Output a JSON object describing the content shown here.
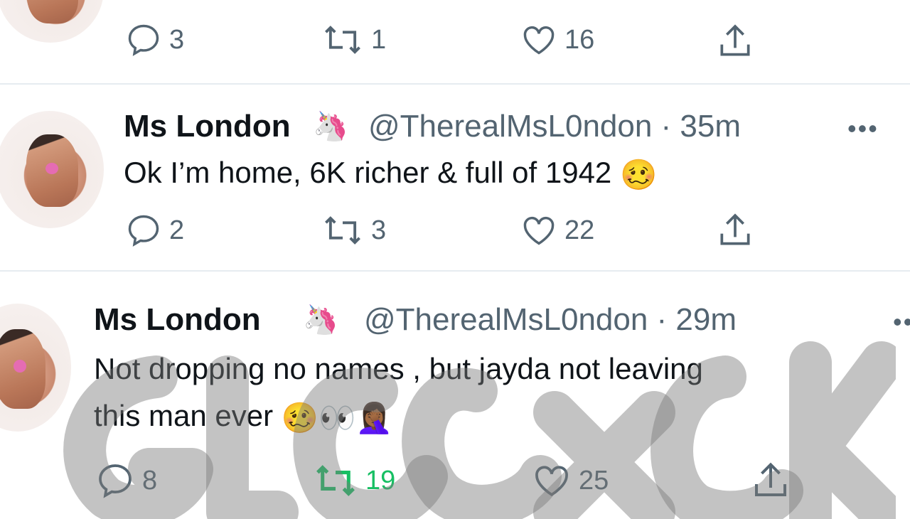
{
  "tweets": [
    {
      "name": "",
      "handle": "",
      "time": "",
      "text": "",
      "replies": "3",
      "retweets": "1",
      "likes": "16"
    },
    {
      "name": "Ms London",
      "handle": "@TherealMsL0ndon · 35m",
      "text": "Ok I’m home, 6K richer & full of 1942",
      "emoji": "🥴",
      "replies": "2",
      "retweets": "3",
      "likes": "22"
    },
    {
      "name": "Ms London",
      "handle": "@TherealMsL0ndon · 29m",
      "text_line1": "Not dropping no names , but jayda not leaving",
      "text_line2": "this man ever",
      "emojis": "🥴👀🤦🏾‍♀️",
      "replies": "8",
      "retweets": "19",
      "likes": "25"
    }
  ],
  "icons": {
    "unicorn": "🦄",
    "more": "•••"
  },
  "colors": {
    "retweet_active": "#17bf63",
    "muted": "#536471",
    "divider": "#e6ecf0"
  }
}
